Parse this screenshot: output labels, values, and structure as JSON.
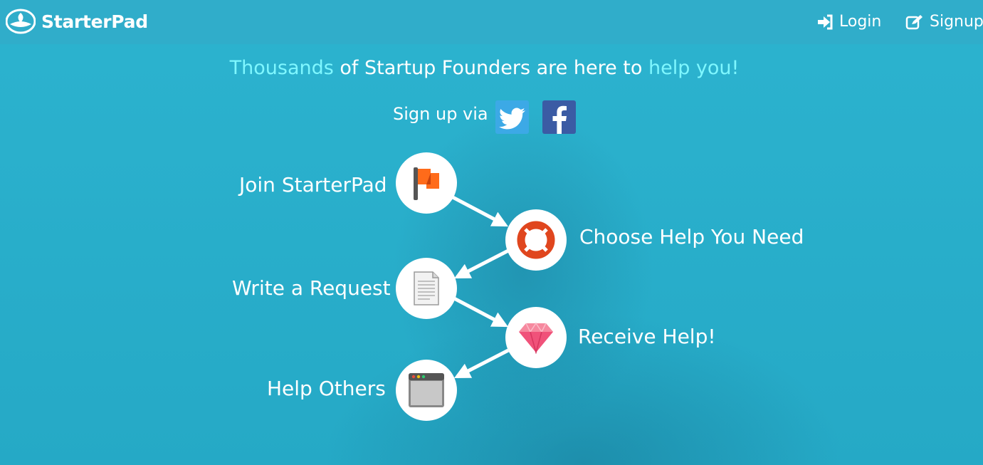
{
  "navbar": {
    "brand": "StarterPad",
    "login_label": "Login",
    "signup_label": "Signup"
  },
  "headline": {
    "part1": "Thousands",
    "part2": " of Startup Founders are here to ",
    "part3": "help you!"
  },
  "signup": {
    "label": "Sign up via"
  },
  "steps": [
    {
      "label": "Join StarterPad",
      "icon": "flag-icon"
    },
    {
      "label": "Choose Help You Need",
      "icon": "lifebuoy-icon"
    },
    {
      "label": "Write a Request",
      "icon": "document-icon"
    },
    {
      "label": "Receive Help!",
      "icon": "diamond-icon"
    },
    {
      "label": "Help Others",
      "icon": "browser-window-icon"
    }
  ],
  "colors": {
    "background": "#2ab0cc",
    "highlight_text": "#7ff7ff",
    "twitter": "#3ca9e6",
    "facebook": "#3b5ba4",
    "flag": "#ff6b1a",
    "lifebuoy": "#e0461e",
    "diamond": "#f0527a"
  }
}
